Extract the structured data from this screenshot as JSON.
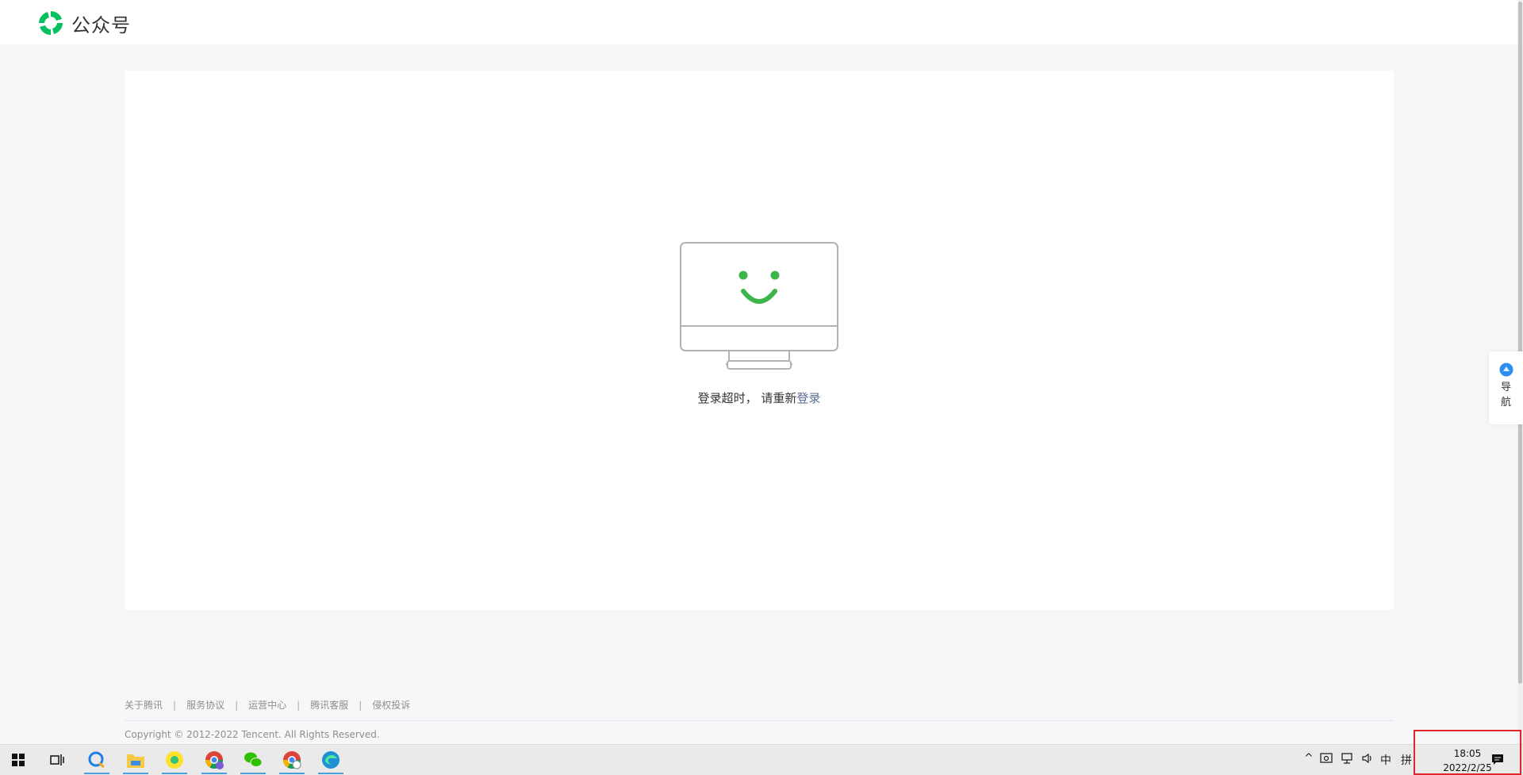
{
  "header": {
    "app_name": "公众号"
  },
  "main": {
    "message_prefix": "登录超时， 请重新",
    "login_link": "登录"
  },
  "side_nav": {
    "label": "导航"
  },
  "footer": {
    "links": [
      "关于腾讯",
      "服务协议",
      "运营中心",
      "腾讯客服",
      "侵权投诉"
    ],
    "separator": "|",
    "copyright": "Copyright © 2012-2022 Tencent. All Rights Reserved."
  },
  "taskbar": {
    "apps": [
      "start-icon",
      "task-view-icon",
      "qq-browser-icon",
      "file-explorer-icon",
      "qq-music-icon",
      "chrome-icon",
      "wechat-icon",
      "chrome-profile-icon",
      "edge-icon"
    ],
    "tray": {
      "ime_label": "中",
      "ime_mode": "拼"
    },
    "clock": {
      "time": "18:05",
      "date": "2022/2/25"
    }
  },
  "colors": {
    "brand_green": "#07c160",
    "link_blue": "#576b95",
    "highlight_red": "#e0252b"
  }
}
